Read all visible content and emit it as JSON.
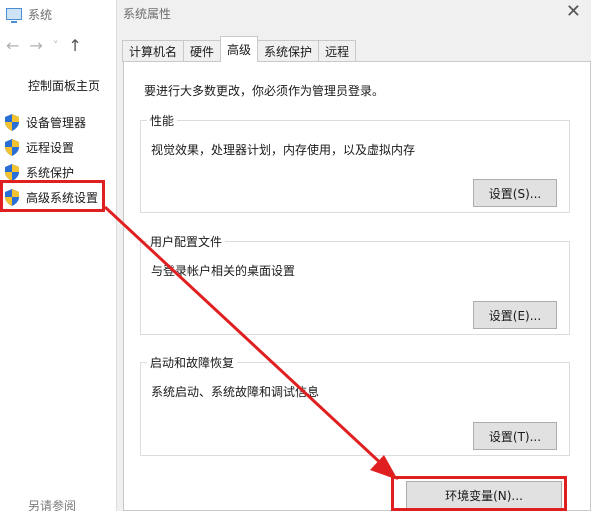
{
  "left_window": {
    "title": "系统",
    "nav": {
      "back": "←",
      "forward": "→",
      "dropdown": "˅",
      "up": "↑"
    },
    "control_panel_home": "控制面板主页",
    "items": [
      {
        "label": "设备管理器"
      },
      {
        "label": "远程设置"
      },
      {
        "label": "系统保护"
      },
      {
        "label": "高级系统设置"
      }
    ],
    "see_also": "另请参阅"
  },
  "dialog": {
    "title": "系统属性",
    "close": "✕",
    "tabs": [
      "计算机名",
      "硬件",
      "高级",
      "系统保护",
      "远程"
    ],
    "active_tab": "高级",
    "admin_note": "要进行大多数更改，你必须作为管理员登录。",
    "performance": {
      "title": "性能",
      "desc": "视觉效果，处理器计划，内存使用，以及虚拟内存",
      "button": "设置(S)..."
    },
    "user_profiles": {
      "title": "用户配置文件",
      "desc": "与登录帐户相关的桌面设置",
      "button": "设置(E)..."
    },
    "startup_recovery": {
      "title": "启动和故障恢复",
      "desc": "系统启动、系统故障和调试信息",
      "button": "设置(T)..."
    },
    "env_button": "环境变量(N)..."
  },
  "annotation_color": "#e02020"
}
